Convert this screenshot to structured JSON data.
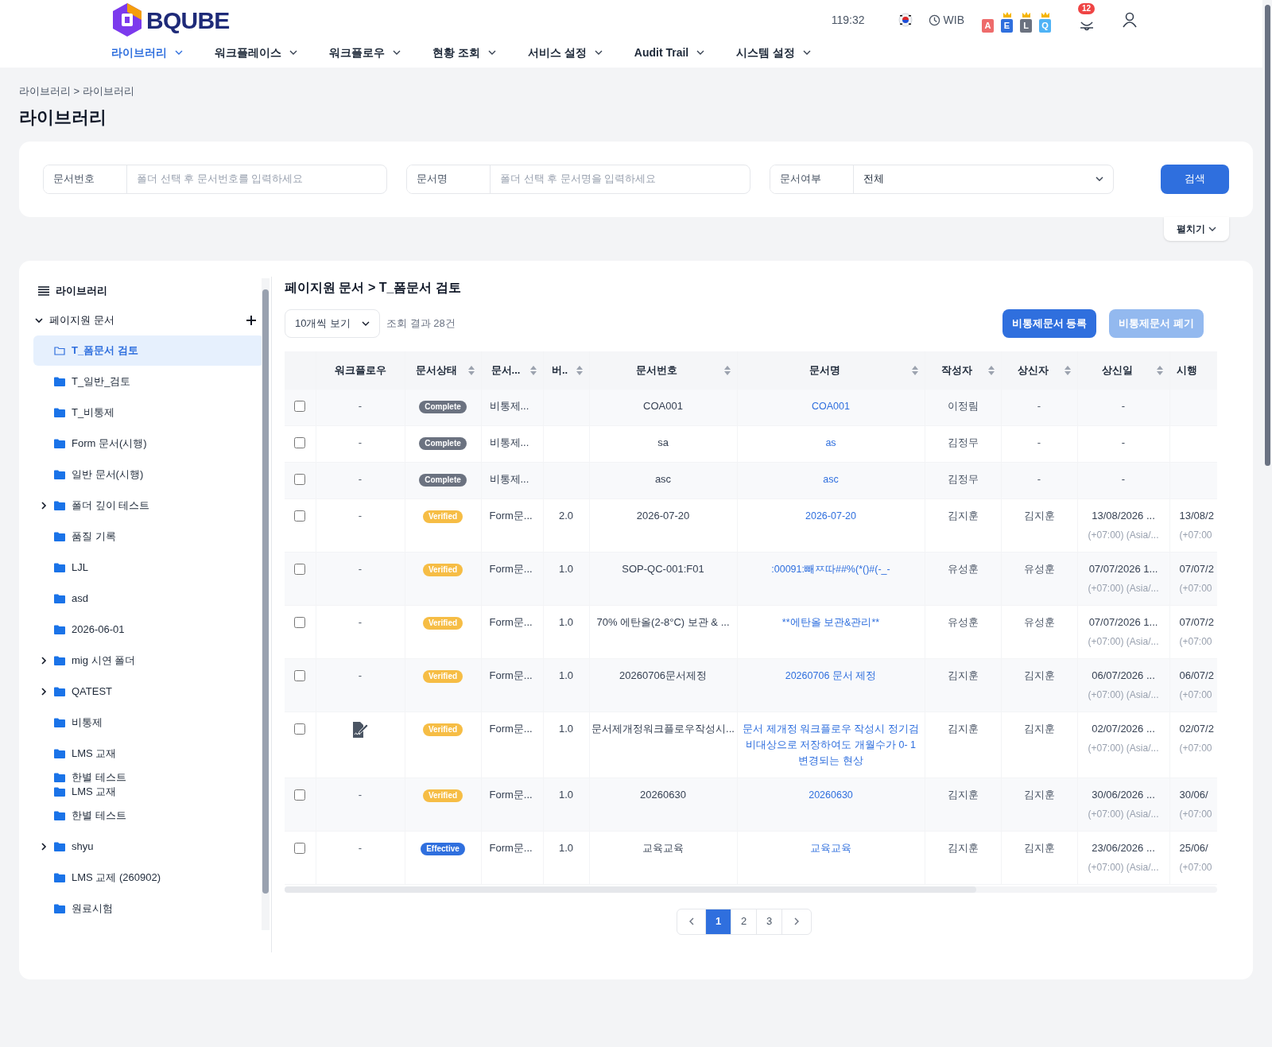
{
  "header": {
    "brand": "BQUBE",
    "time": "119:32",
    "timezone": "WIB",
    "role_badges": [
      {
        "letter": "A",
        "color": "#ee6b6b",
        "crown": false
      },
      {
        "letter": "E",
        "color": "#2f6fde",
        "crown": true
      },
      {
        "letter": "L",
        "color": "#6b7280",
        "crown": true
      },
      {
        "letter": "Q",
        "color": "#4fb3f6",
        "crown": true
      }
    ],
    "notification_count": "12"
  },
  "nav": [
    {
      "label": "라이브러리",
      "selected": true
    },
    {
      "label": "워크플레이스",
      "selected": false
    },
    {
      "label": "워크플로우",
      "selected": false
    },
    {
      "label": "현황 조회",
      "selected": false
    },
    {
      "label": "서비스 설정",
      "selected": false
    },
    {
      "label": "Audit Trail",
      "selected": false
    },
    {
      "label": "시스템 설정",
      "selected": false
    }
  ],
  "breadcrumb": "라이브러리 > 라이브러리",
  "page_title": "라이브러리",
  "search": {
    "fields": [
      {
        "kind": "text",
        "label": "문서번호",
        "placeholder": "폴더 선택 후 문서번호를 입력하세요"
      },
      {
        "kind": "text",
        "label": "문서명",
        "placeholder": "폴더 선택 후 문서명을 입력하세요"
      },
      {
        "kind": "select",
        "label": "문서여부",
        "value": "전체"
      }
    ],
    "button": "검색",
    "expand_button": "펼치기"
  },
  "sidebar": {
    "title": "라이브러리",
    "tree": [
      {
        "label": "페이지원 문서",
        "has_children": true,
        "expanded": true,
        "selected": false,
        "children": [
          {
            "label": "T_폼문서 검토",
            "has_children": false,
            "expanded": false,
            "selected": true
          },
          {
            "label": "T_일반_검토",
            "has_children": false,
            "expanded": false,
            "selected": false
          },
          {
            "label": "T_비통제",
            "has_children": false,
            "expanded": false,
            "selected": false
          },
          {
            "label": "Form 문서(시행)",
            "has_children": false,
            "expanded": false,
            "selected": false
          },
          {
            "label": "일반 문서(시행)",
            "has_children": false,
            "expanded": false,
            "selected": false
          },
          {
            "label": "폴더 깊이 테스트",
            "has_children": true,
            "expanded": false,
            "selected": false
          },
          {
            "label": "품질 기록",
            "has_children": false,
            "expanded": false,
            "selected": false
          },
          {
            "label": "LJL",
            "has_children": false,
            "expanded": false,
            "selected": false
          },
          {
            "label": "asd",
            "has_children": false,
            "expanded": false,
            "selected": false
          },
          {
            "label": "2026-06-01",
            "has_children": false,
            "expanded": false,
            "selected": false
          },
          {
            "label": "mig 시연 폴더",
            "has_children": true,
            "expanded": false,
            "selected": false
          },
          {
            "label": "QATEST",
            "has_children": true,
            "expanded": false,
            "selected": false
          },
          {
            "label": "비통제",
            "has_children": false,
            "expanded": false,
            "selected": false
          },
          {
            "label": "LMS 교재",
            "has_children": false,
            "expanded": false,
            "selected": false
          },
          {
            "label": "한별 테스트",
            "has_children": false,
            "expanded": false,
            "selected": false,
            "kind": "overlapped"
          },
          {
            "label": "LMS 교재",
            "has_children": false,
            "expanded": false,
            "selected": false,
            "kind": "overlapped"
          },
          {
            "label": "한별 테스트",
            "has_children": false,
            "expanded": false,
            "selected": false
          },
          {
            "label": "shyu",
            "has_children": true,
            "expanded": false,
            "selected": false
          },
          {
            "label": "LMS 교제 (260902)",
            "has_children": false,
            "expanded": false,
            "selected": false
          },
          {
            "label": "원료시험",
            "has_children": false,
            "expanded": false,
            "selected": false
          }
        ]
      }
    ]
  },
  "content": {
    "path": "페이지원 문서 > T_폼문서 검토",
    "page_size": "10개씩 보기",
    "result_count": "조회 결과 28건",
    "buttons": [
      {
        "label": "비통제문서 등록",
        "disabled": false
      },
      {
        "label": "비통제문서 폐기",
        "disabled": true
      }
    ]
  },
  "table": {
    "columns": [
      {
        "label": "워크플로우",
        "sortable": false
      },
      {
        "label": "문서상태",
        "sortable": true
      },
      {
        "label": "문서...",
        "sortable": true
      },
      {
        "label": "버..",
        "sortable": true
      },
      {
        "label": "문서번호",
        "sortable": true
      },
      {
        "label": "문서명",
        "sortable": true
      },
      {
        "label": "작성자",
        "sortable": true
      },
      {
        "label": "상신자",
        "sortable": true
      },
      {
        "label": "상신일",
        "sortable": true
      },
      {
        "label": "시행",
        "sortable": false
      }
    ],
    "rows": [
      {
        "checked": false,
        "workflow": {
          "kind": "text",
          "text": "-"
        },
        "status": {
          "kind": "complete",
          "label": "Complete"
        },
        "doc_type": "비통제...",
        "doc_no": "COA001",
        "doc_name": "COA001",
        "author": "이정림",
        "submitter": "-",
        "submit_date": "-"
      },
      {
        "checked": false,
        "workflow": {
          "kind": "text",
          "text": "-"
        },
        "status": {
          "kind": "complete",
          "label": "Complete"
        },
        "doc_type": "비통제...",
        "doc_no": "sa",
        "doc_name": "as",
        "author": "김정무",
        "submitter": "-",
        "submit_date": "-"
      },
      {
        "checked": false,
        "workflow": {
          "kind": "text",
          "text": "-"
        },
        "status": {
          "kind": "complete",
          "label": "Complete"
        },
        "doc_type": "비통제...",
        "doc_no": "asc",
        "doc_name": "asc",
        "author": "김정무",
        "submitter": "-",
        "submit_date": "-"
      },
      {
        "checked": false,
        "workflow": {
          "kind": "text",
          "text": "-"
        },
        "status": {
          "kind": "verified",
          "label": "Verified"
        },
        "doc_type": "Form문...",
        "version": "2.0",
        "doc_no": "2026-07-20",
        "doc_name": "2026-07-20",
        "author": "김지훈",
        "submitter": "김지훈",
        "submit_date": "13/08/2026 ...",
        "submit_zone": "(+07:00) (Asia/...",
        "effective_date": "13/08/2",
        "effective_zone": "(+07:00"
      },
      {
        "checked": false,
        "workflow": {
          "kind": "text",
          "text": "-"
        },
        "status": {
          "kind": "verified",
          "label": "Verified"
        },
        "doc_type": "Form문...",
        "version": "1.0",
        "doc_no": "SOP-QC-001:F01",
        "doc_name": ":00091:빼ㅉ따##%(*()#(-_-",
        "author": "유성훈",
        "submitter": "유성훈",
        "submit_date": "07/07/2026 1...",
        "submit_zone": "(+07:00) (Asia/...",
        "effective_date": "07/07/2",
        "effective_zone": "(+07:00"
      },
      {
        "checked": false,
        "workflow": {
          "kind": "text",
          "text": "-"
        },
        "status": {
          "kind": "verified",
          "label": "Verified"
        },
        "doc_type": "Form문...",
        "version": "1.0",
        "doc_no": "70% 에탄올(2-8°C) 보관 & ...",
        "doc_name": "**에탄올 보관&관리**",
        "author": "유성훈",
        "submitter": "유성훈",
        "submit_date": "07/07/2026 1...",
        "submit_zone": "(+07:00) (Asia/...",
        "effective_date": "07/07/2",
        "effective_zone": "(+07:00"
      },
      {
        "checked": false,
        "workflow": {
          "kind": "text",
          "text": "-"
        },
        "status": {
          "kind": "verified",
          "label": "Verified"
        },
        "doc_type": "Form문...",
        "version": "1.0",
        "doc_no": "20260706문서제정",
        "doc_name": "20260706 문서 제정",
        "author": "김지훈",
        "submitter": "김지훈",
        "submit_date": "06/07/2026 ...",
        "submit_zone": "(+07:00) (Asia/...",
        "effective_date": "06/07/2",
        "effective_zone": "(+07:00"
      },
      {
        "checked": false,
        "workflow": {
          "kind": "icon"
        },
        "status": {
          "kind": "verified",
          "label": "Verified"
        },
        "doc_type": "Form문...",
        "version": "1.0",
        "doc_no": "문서제개정워크플로우작성시...",
        "doc_name": "문서 제개정 워크플로우 작성시 정기검\n비대상으로 저장하여도 개월수가 0- 1\n변경되는 현상",
        "author": "김지훈",
        "submitter": "김지훈",
        "submit_date": "02/07/2026 ...",
        "submit_zone": "(+07:00) (Asia/...",
        "effective_date": "02/07/2",
        "effective_zone": "(+07:00"
      },
      {
        "checked": false,
        "workflow": {
          "kind": "text",
          "text": "-"
        },
        "status": {
          "kind": "verified",
          "label": "Verified"
        },
        "doc_type": "Form문...",
        "version": "1.0",
        "doc_no": "20260630",
        "doc_name": "20260630",
        "author": "김지훈",
        "submitter": "김지훈",
        "submit_date": "30/06/2026 ...",
        "submit_zone": "(+07:00) (Asia/...",
        "effective_date": "30/06/",
        "effective_zone": "(+07:00"
      },
      {
        "checked": false,
        "workflow": {
          "kind": "text",
          "text": "-"
        },
        "status": {
          "kind": "effective",
          "label": "Effective"
        },
        "doc_type": "Form문...",
        "version": "1.0",
        "doc_no": "교육교육",
        "doc_name": "교육교육",
        "author": "김지훈",
        "submitter": "김지훈",
        "submit_date": "23/06/2026 ...",
        "submit_zone": "(+07:00) (Asia/...",
        "effective_date": "25/06/",
        "effective_zone": "(+07:00"
      }
    ]
  },
  "pagination": {
    "pages": [
      {
        "label": "1",
        "selected": true
      },
      {
        "label": "2",
        "selected": false
      },
      {
        "label": "3",
        "selected": false
      }
    ]
  }
}
